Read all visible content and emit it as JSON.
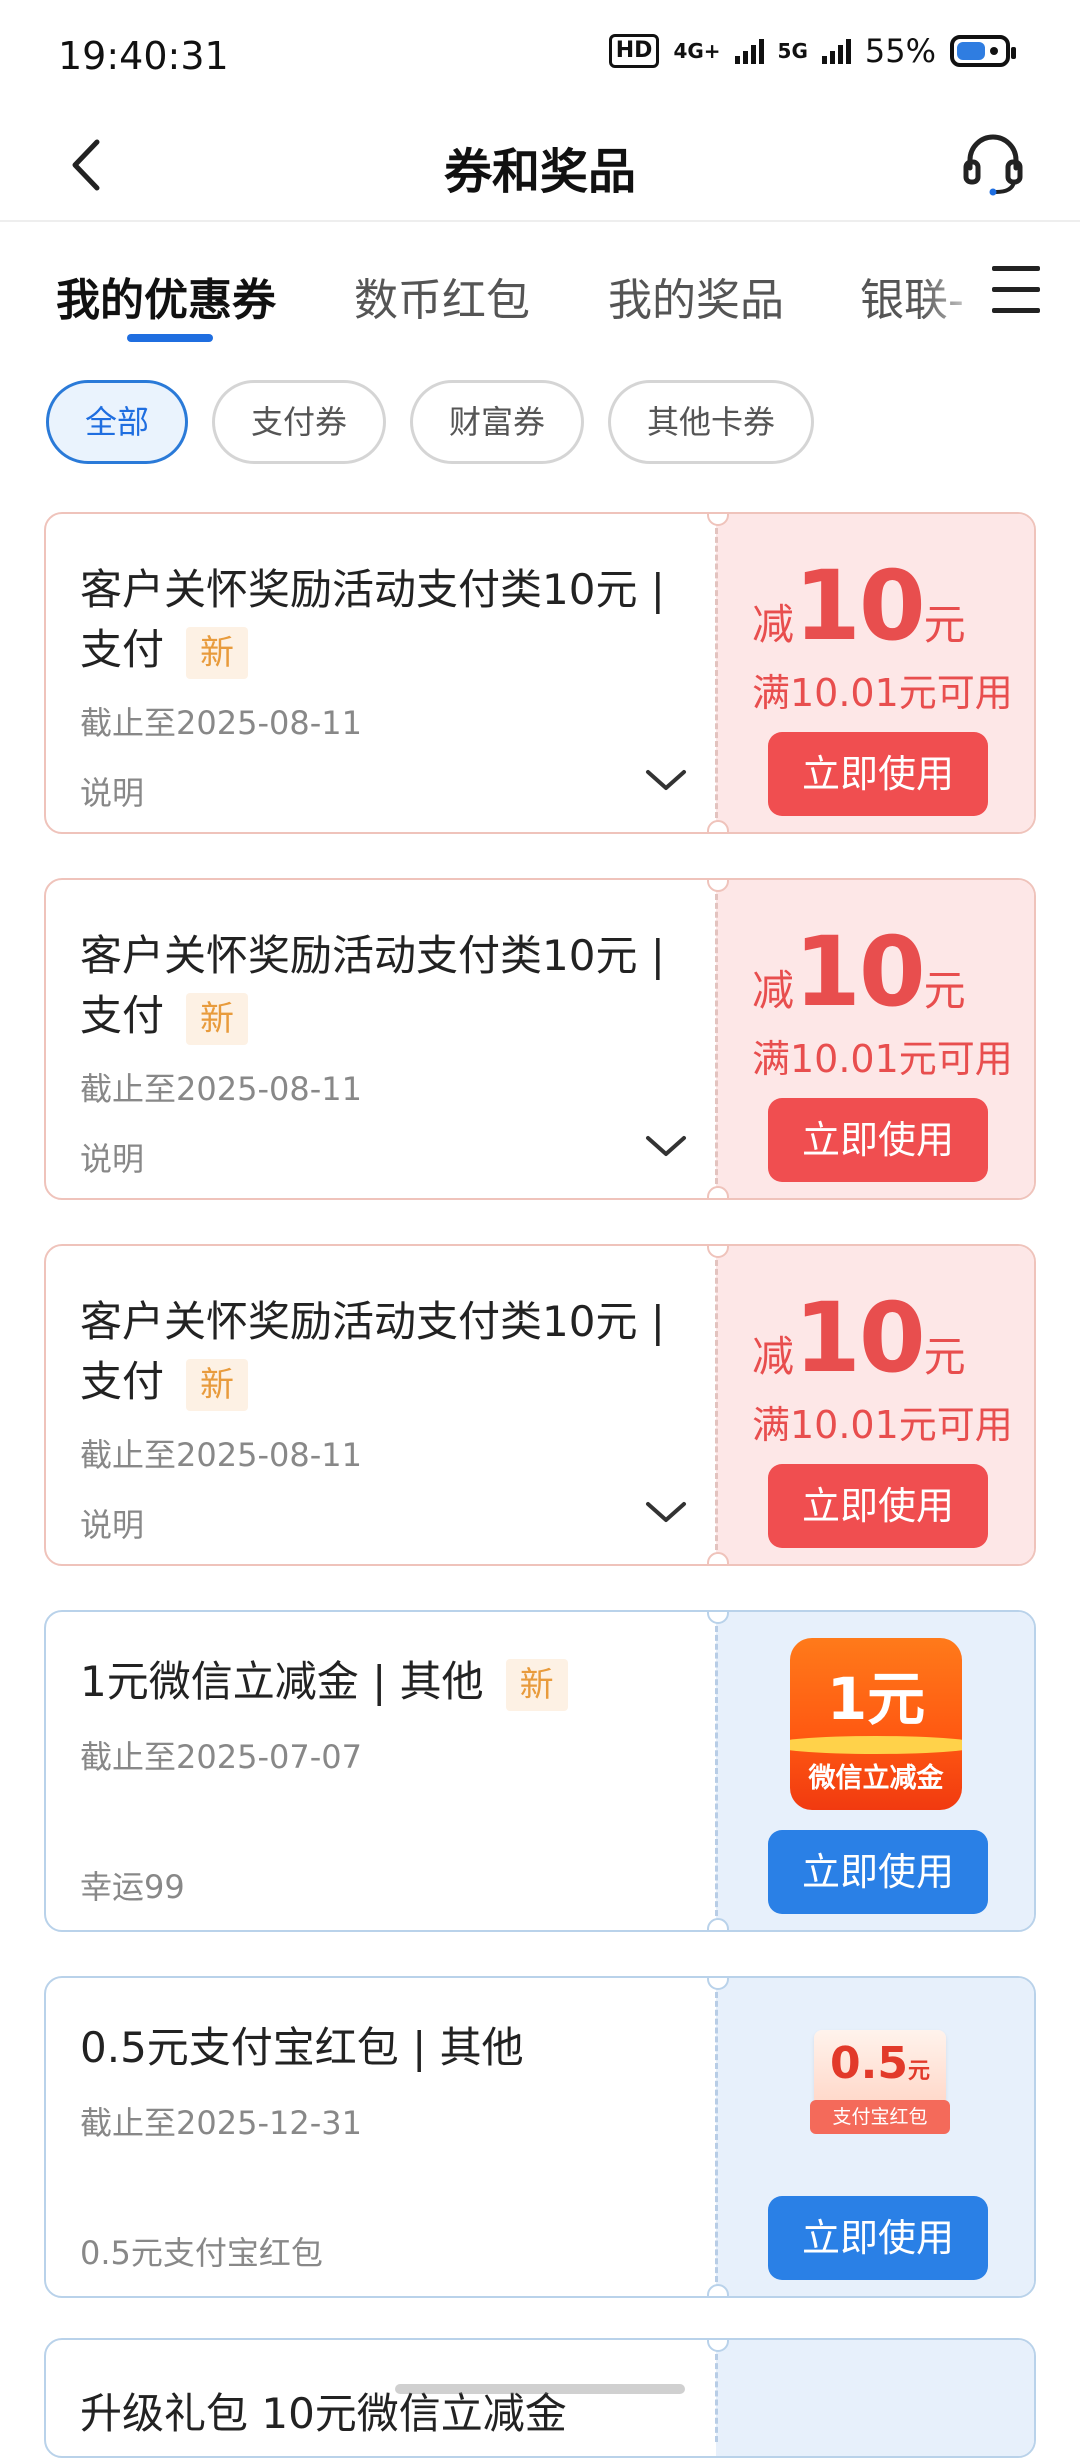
{
  "status_bar": {
    "time": "19:40:31",
    "hd_label": "HD",
    "sim1_network": "4G+",
    "sim2_network": "5G",
    "battery": "55%"
  },
  "header": {
    "title": "券和奖品",
    "back_icon": "chevron-left-icon",
    "service_icon": "headset-icon"
  },
  "tabs": [
    {
      "label": "我的优惠券",
      "active": true
    },
    {
      "label": "数币红包",
      "active": false
    },
    {
      "label": "我的奖品",
      "active": false
    },
    {
      "label": "银联-",
      "active": false
    }
  ],
  "filters": [
    {
      "label": "全部",
      "active": true
    },
    {
      "label": "支付券",
      "active": false
    },
    {
      "label": "财富券",
      "active": false
    },
    {
      "label": "其他卡券",
      "active": false
    }
  ],
  "coupons": [
    {
      "title": "客户关怀奖励活动支付类10元 | 支付",
      "tag": "新",
      "expiry": "截止至2025-08-11",
      "note": "说明",
      "prefix": "减",
      "amount": "10",
      "unit": "元",
      "condition": "满10.01元可用",
      "button": "立即使用"
    },
    {
      "title": "客户关怀奖励活动支付类10元 | 支付",
      "tag": "新",
      "expiry": "截止至2025-08-11",
      "note": "说明",
      "prefix": "减",
      "amount": "10",
      "unit": "元",
      "condition": "满10.01元可用",
      "button": "立即使用"
    },
    {
      "title": "客户关怀奖励活动支付类10元 | 支付",
      "tag": "新",
      "expiry": "截止至2025-08-11",
      "note": "说明",
      "prefix": "减",
      "amount": "10",
      "unit": "元",
      "condition": "满10.01元可用",
      "button": "立即使用"
    }
  ],
  "prizes": [
    {
      "title": "1元微信立减金 | 其他",
      "tag": "新",
      "expiry": "截止至2025-07-07",
      "note": "幸运99",
      "badge_amount": "1元",
      "badge_label": "微信立减金",
      "button": "立即使用"
    },
    {
      "title": "0.5元支付宝红包 | 其他",
      "expiry": "截止至2025-12-31",
      "note": "0.5元支付宝红包",
      "badge_amount": "0.5",
      "badge_unit": "元",
      "badge_label": "支付宝红包",
      "button": "立即使用"
    }
  ],
  "partial_item": {
    "title": "升级礼包 10元微信立减金"
  },
  "colors": {
    "primary_blue": "#1f6ee0",
    "coupon_red": "#f04e50",
    "coupon_bg": "#fde7e7",
    "prize_bg": "#e7f0fb",
    "new_tag": "#e89b3c"
  }
}
